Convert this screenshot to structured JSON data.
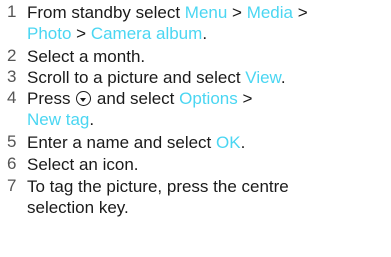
{
  "steps": [
    {
      "number": "1",
      "lines": [
        [
          "From standby select ",
          "Menu",
          " > ",
          "Media",
          " >"
        ],
        [
          "Photo",
          " > ",
          "Camera album",
          "."
        ]
      ]
    },
    {
      "number": "2",
      "text": "Select a month."
    },
    {
      "number": "3",
      "text": "Scroll to a picture and select ",
      "highlight": "View",
      "end": "."
    },
    {
      "number": "4",
      "pre": "Press ",
      "icon": "navigation-key-icon",
      "mid": " and select ",
      "highlight": "Options",
      "after": " >",
      "highlight2": "New tag",
      "end": "."
    },
    {
      "number": "5",
      "text": "Enter a name and select ",
      "highlight": "OK",
      "end": "."
    },
    {
      "number": "6",
      "text": "Select an icon."
    },
    {
      "number": "7",
      "lines": [
        "To tag the picture, press the centre",
        "selection key."
      ]
    }
  ],
  "colors": {
    "highlight": "#4ad6f2",
    "text": "#1a1a1a",
    "number": "#555555"
  }
}
